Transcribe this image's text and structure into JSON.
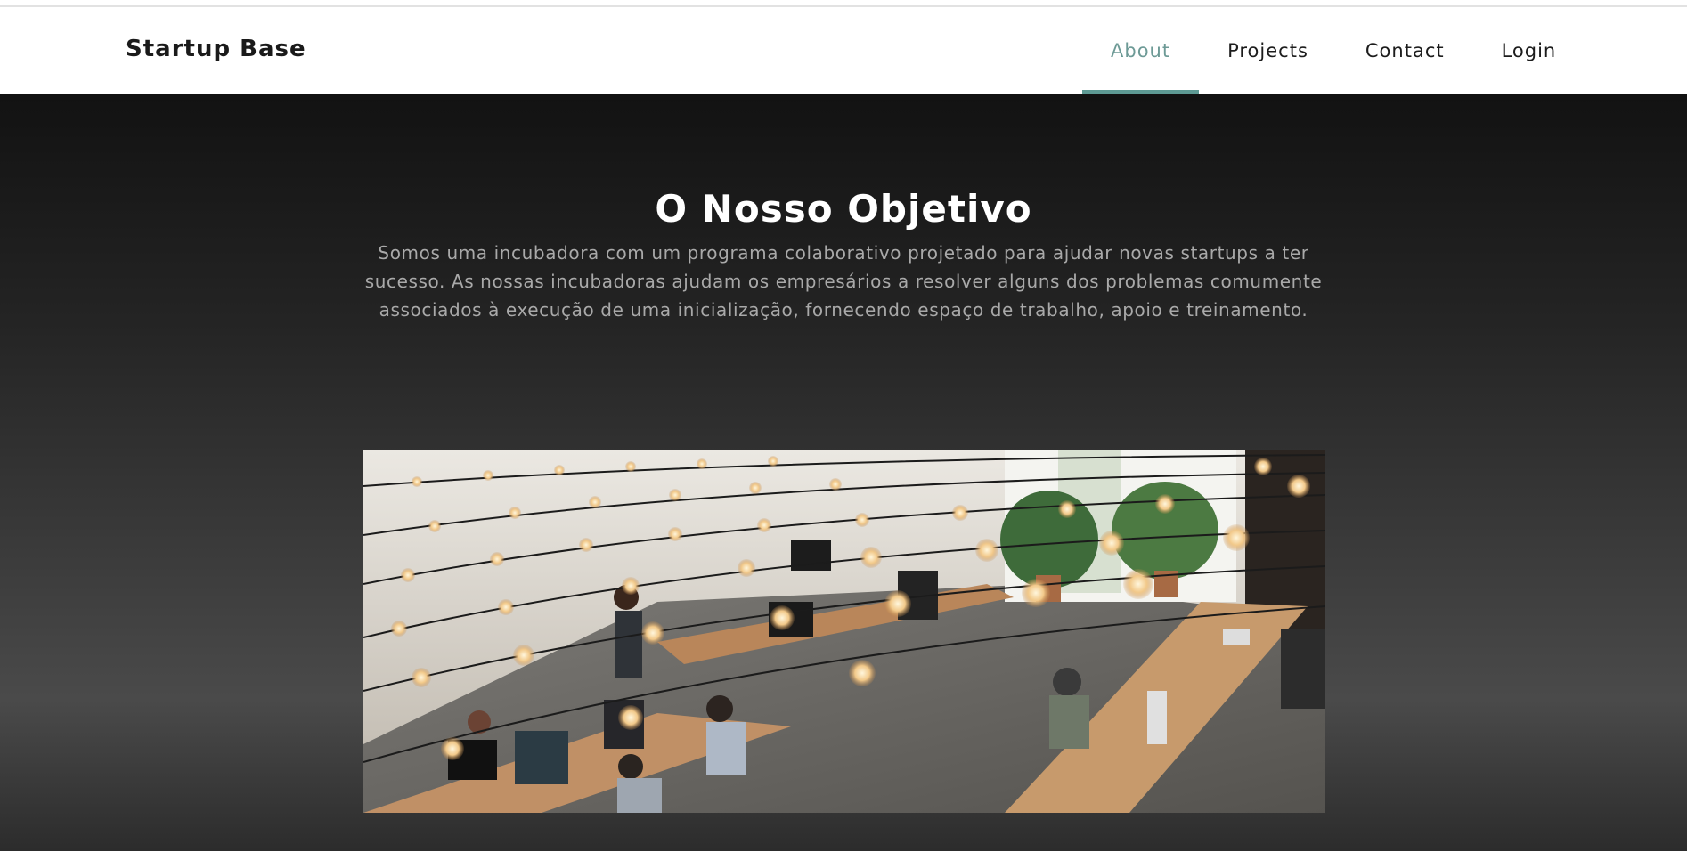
{
  "brand": "Startup Base",
  "nav": {
    "about": "About",
    "projects": "Projects",
    "contact": "Contact",
    "login": "Login"
  },
  "hero": {
    "title": "O Nosso Objetivo",
    "description": "Somos uma incubadora com um programa colaborativo projetado para ajudar novas startups a ter sucesso. As nossas incubadoras ajudam os empresários a resolver alguns dos problemas comumente associados à execução de uma inicialização, fornecendo espaço de trabalho, apoio e treinamento."
  },
  "colors": {
    "accent": "#5e9a94",
    "hero_bg_top": "#121212",
    "hero_bg_mid": "#4a4a4a"
  }
}
